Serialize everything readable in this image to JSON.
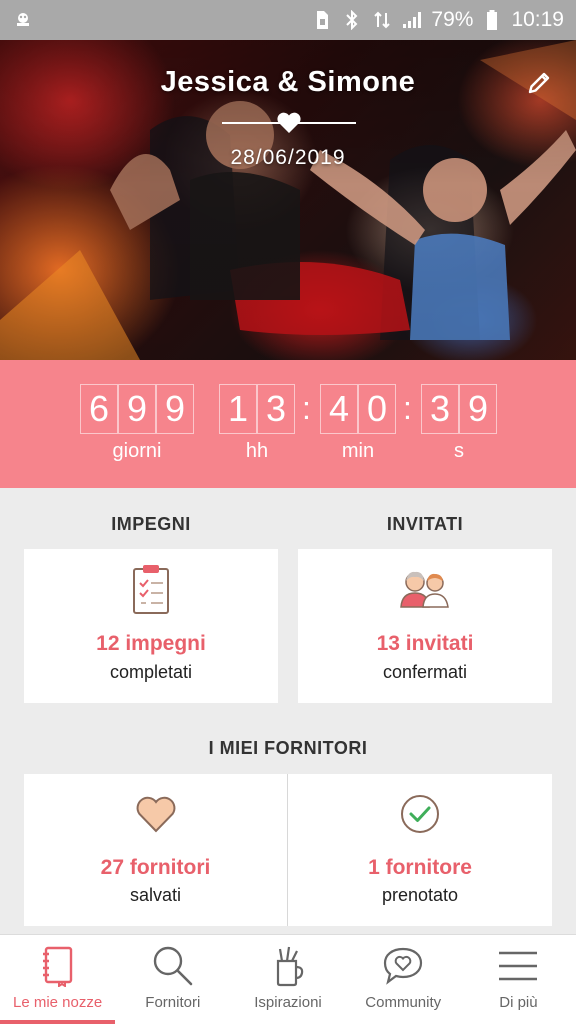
{
  "status_bar": {
    "battery_percent": "79%",
    "time": "10:19"
  },
  "header": {
    "couple_names": "Jessica & Simone",
    "wedding_date": "28/06/2019"
  },
  "countdown": {
    "days": [
      "6",
      "9",
      "9"
    ],
    "hours": [
      "1",
      "3"
    ],
    "minutes": [
      "4",
      "0"
    ],
    "seconds": [
      "3",
      "9"
    ],
    "separator": ":",
    "labels": {
      "days": "giorni",
      "hours": "hh",
      "minutes": "min",
      "seconds": "s"
    }
  },
  "impegni": {
    "title": "IMPEGNI",
    "count": "12 impegni",
    "sub": "completati"
  },
  "invitati": {
    "title": "INVITATI",
    "count": "13 invitati",
    "sub": "confermati"
  },
  "fornitori": {
    "title": "I MIEI FORNITORI",
    "saved_count": "27 fornitori",
    "saved_sub": "salvati",
    "booked_count": "1 fornitore",
    "booked_sub": "prenotato"
  },
  "bottom_nav": {
    "items": [
      {
        "label": "Le mie nozze",
        "icon": "notebook-icon",
        "active": true
      },
      {
        "label": "Fornitori",
        "icon": "search-icon",
        "active": false
      },
      {
        "label": "Ispirazioni",
        "icon": "pencil-cup-icon",
        "active": false
      },
      {
        "label": "Community",
        "icon": "chat-heart-icon",
        "active": false
      },
      {
        "label": "Di più",
        "icon": "menu-icon",
        "active": false
      }
    ]
  },
  "colors": {
    "accent": "#e8606b",
    "countdown_bg": "#f6848c",
    "page_bg": "#ececec",
    "status_bar_bg": "#a9a9a9"
  }
}
